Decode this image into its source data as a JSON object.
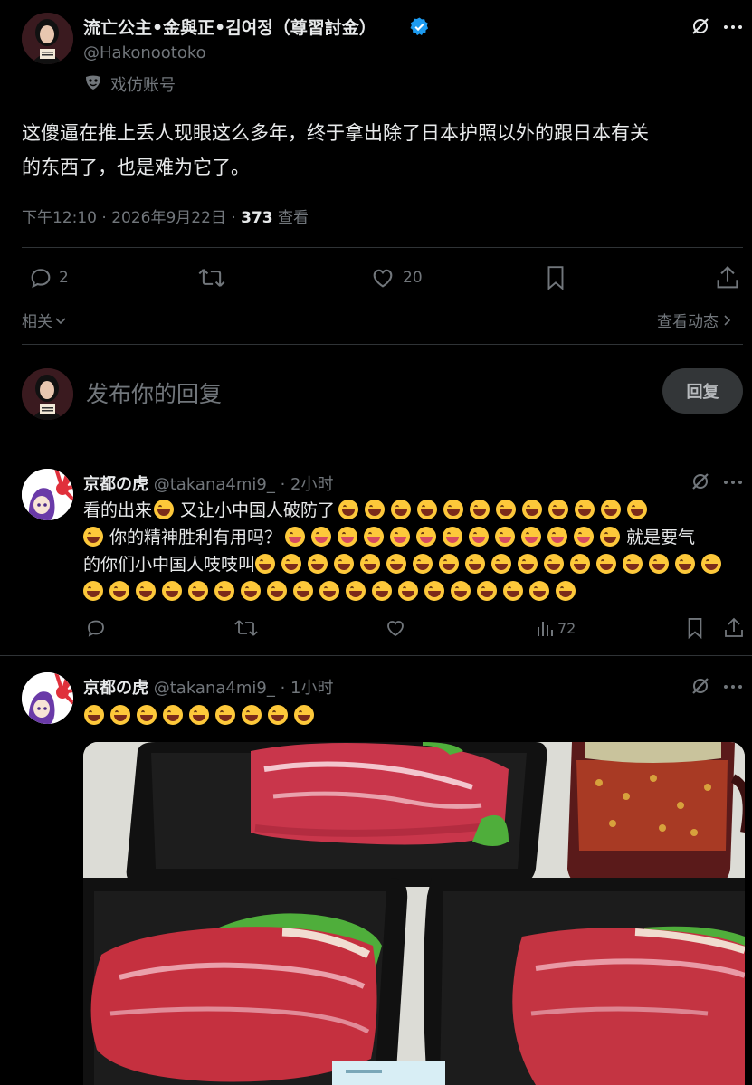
{
  "main_post": {
    "display_name": "流亡公主•金與正•김여정（尊習討金）",
    "handle": "@Hakonootoko",
    "label": "戏仿账号",
    "text_line1": "这傻逼在推上丢人现眼这么多年，终于拿出除了日本护照以外的跟日本有关",
    "text_line2": "的东西了，也是难为它了。",
    "time": "下午12:10 · 2026年9月22日 · ",
    "views": "373",
    "views_label": " 查看",
    "replies": "2",
    "likes": "20",
    "related_label": "相关",
    "activity_label": "查看动态"
  },
  "composer": {
    "placeholder": "发布你的回复",
    "reply_button": "回复"
  },
  "replies": [
    {
      "display_name": "京都の虎",
      "handle": "@takana4mi9_",
      "time": "· 2小时",
      "text_a": "看的出来",
      "text_b": "又让小中国人破防了",
      "text_c": "你的精神胜利有用吗？",
      "text_d": "就是要气",
      "text_e": "的你们小中国人吱吱叫",
      "views": "72"
    },
    {
      "display_name": "京都の虎",
      "handle": "@takana4mi9_",
      "time": "· 1小时"
    }
  ],
  "colors": {
    "verified": "#1d9bf0",
    "accent_text": "#e7e9ea",
    "muted": "#71767b",
    "divider": "#2f3336"
  }
}
